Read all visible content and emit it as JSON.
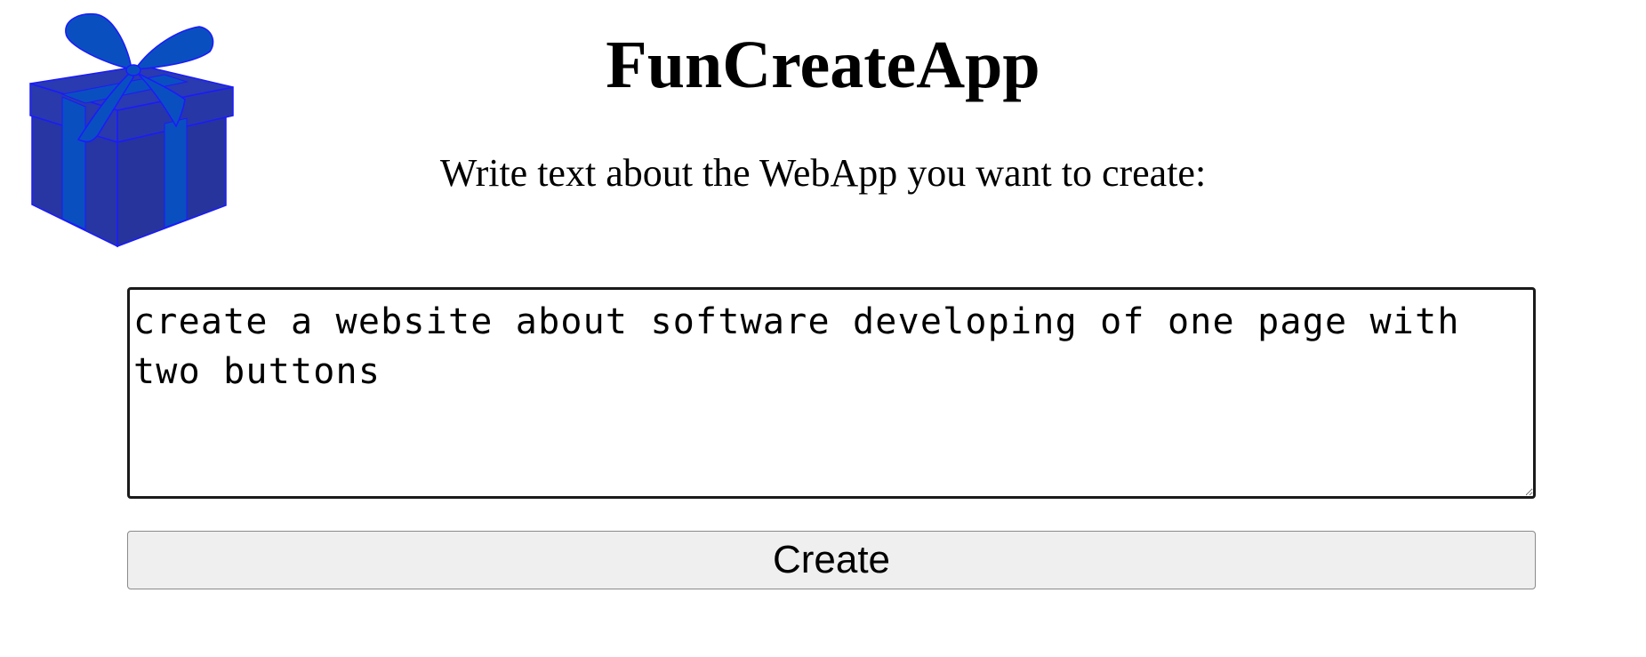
{
  "app": {
    "title": "FunCreateApp",
    "instruction": "Write text about the WebApp you want to create:"
  },
  "prompt": {
    "value": "create a website about software developing of one page with two buttons"
  },
  "actions": {
    "create_label": "Create"
  },
  "icons": {
    "logo": "gift-box-icon"
  },
  "colors": {
    "gift_box": "#2635a0",
    "gift_ribbon": "#0a4fbf",
    "gift_outline": "#1a1aff",
    "button_background": "#efefef"
  }
}
